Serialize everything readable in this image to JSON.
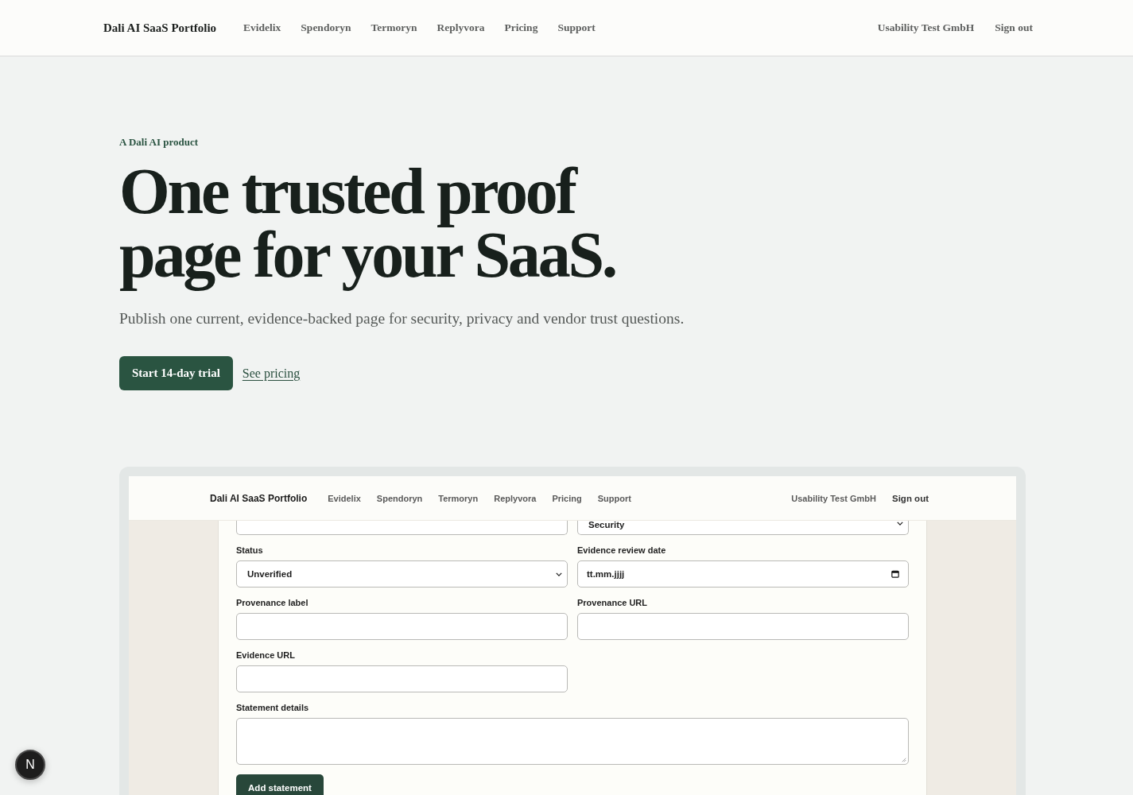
{
  "nav": {
    "brand": "Dali AI SaaS Portfolio",
    "links": [
      "Evidelix",
      "Spendoryn",
      "Termoryn",
      "Replyvora",
      "Pricing",
      "Support"
    ],
    "account": "Usability Test GmbH",
    "sign_out": "Sign out"
  },
  "hero": {
    "eyebrow": "A Dali AI product",
    "headline": "One trusted proof page for your SaaS.",
    "subtitle": "Publish one current, evidence-backed page for security, privacy and vendor trust questions.",
    "primary_button": "Start 14-day trial",
    "secondary_link": "See pricing"
  },
  "preview": {
    "nav": {
      "brand": "Dali AI SaaS Portfolio",
      "links": [
        "Evidelix",
        "Spendoryn",
        "Termoryn",
        "Replyvora",
        "Pricing",
        "Support"
      ],
      "account": "Usability Test GmbH",
      "sign_out": "Sign out"
    },
    "form": {
      "top_row": [
        {
          "kind": "input"
        },
        {
          "kind": "select",
          "value": "Security"
        }
      ],
      "fields": [
        {
          "kind": "select",
          "label": "Status",
          "value": "Unverified"
        },
        {
          "kind": "date",
          "label": "Evidence review date",
          "placeholder": "tt.mm.jjjj"
        },
        {
          "kind": "input",
          "label": "Provenance label"
        },
        {
          "kind": "input",
          "label": "Provenance URL"
        },
        {
          "kind": "input",
          "label": "Evidence URL"
        },
        {
          "kind": "textarea",
          "label": "Statement details"
        }
      ],
      "submit": "Add statement"
    }
  },
  "dev_indicator": {
    "label": "N"
  }
}
